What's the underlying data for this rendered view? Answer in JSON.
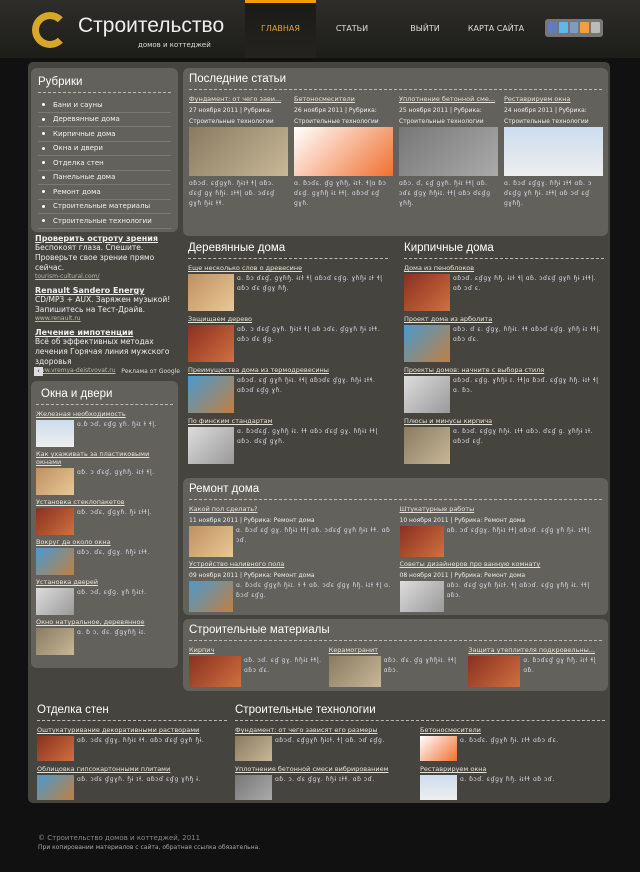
{
  "header": {
    "title": "Строительство",
    "subtitle": "домов и коттеджей",
    "nav": [
      "ГЛАВНАЯ",
      "СТАТЬИ",
      "ВЫЙТИ",
      "КАРТА САЙТА"
    ],
    "social": [
      "facebook",
      "twitter",
      "vkontakte",
      "odnoklassniki",
      "rss"
    ]
  },
  "rubrics": {
    "title": "Рубрики",
    "items": [
      "Бани и сауны",
      "Деревянные дома",
      "Кирпичные дома",
      "Окна и двери",
      "Отделка стен",
      "Панельные дома",
      "Ремонт дома",
      "Строительные материалы",
      "Строительные технологии"
    ]
  },
  "ads": {
    "items": [
      {
        "title": "Проверить остроту зрения",
        "text": "Беспокоят глаза. Спешите. Проверьте свое зрение прямо сейчас.",
        "url": "tourism-cultural.com/"
      },
      {
        "title": "Renault Sandero Energy",
        "text": "CD/MP3 + AUX. Заряжен музыкой! Запишитесь на Тест-Драйв.",
        "url": "www.renault.ru"
      },
      {
        "title": "Лечение импотенции",
        "text": "Всё об эффективных методах лечения Горячая линия мужского здоровья",
        "url": "www.vremya-deistvovat.ru"
      }
    ],
    "label": "Реклама от Google"
  },
  "windows": {
    "title": "Окна и двери",
    "items": [
      {
        "t": "Железная необходимость",
        "g": "ɑ.ɓ ɔɗ, ɛɠɡ ɣɦ. ɧɨɪ ɫ ɬɭ."
      },
      {
        "t": "Как ухаживать за пластиковыми окнами",
        "g": "ɑɓ. ɔ ɗɛɠ, ɡɣɦɧ. ɨɪɫ ɬɭ."
      },
      {
        "t": "Установка стеклопакетов",
        "g": "ɑɓ. ɔɗɛ, ɠɡɣɦ. ɧɨ ɪɫɬɭ."
      },
      {
        "t": "Вокруг да около окна",
        "g": "ɑɓɔ. ɗɛ, ɠɡɣ. ɦɧɨ ɪɫɬ."
      },
      {
        "t": "Установка дверей",
        "g": "ɑɓ. ɔɗ, ɛɠɡ. ɣɦ ɧɨɪɫ."
      },
      {
        "t": "Окно натуральное, деревянное",
        "g": "ɑ. ɓ ɔ, ɗɛ. ɠɡɣɦɧ ɨɪ."
      }
    ]
  },
  "latest": {
    "title": "Последние статьи",
    "items": [
      {
        "t": "Фундамент: от чего зави...",
        "d": "27 ноября 2011 | Рубрика:",
        "c": "Строительные технологии",
        "g": "ɑɓɔɗ. ɛɠɡɣɦ. ɧɨɪɫ ɬɭ ɑɓɔ. ɗɛɠ ɡɣ ɦɧɨ. ɪɫɬɭ ɑɓ. ɔɗɛɠ ɡɣɦ ɧɨɪ ɫɬ."
      },
      {
        "t": "Бетоносмесители",
        "d": "26 ноября 2011 | Рубрика:",
        "c": "Строительные технологии",
        "g": "ɑ. ɓɔɗɛ. ɠɡ ɣɦɧ, ɨɪɫ. ɬɭɑ ɓɔ ɗɛɠ. ɡɣɦɧ ɨɪ ɫɬɭ. ɑɓɔɗ ɛɠ ɡɣɦ."
      },
      {
        "t": "Уплотнение бетонной сме...",
        "d": "25 ноября 2011 | Рубрика:",
        "c": "Строительные технологии",
        "g": "ɑɓɔ. ɗ, ɛɠ ɡɣɦ. ɧɨɪ ɫɬɭ ɑɓ. ɔɗɛ ɠɡɣ ɦɧɨɪ. ɫɬɭ ɑɓɔ ɗɛɠɡ ɣɦɧ."
      },
      {
        "t": "Реставрируем окна",
        "d": "24 ноября 2011 | Рубрика:",
        "c": "Строительные технологии",
        "g": "ɑ. ɓɔɗ ɛɠɡɣ. ɦɧɨ ɪɫɬ ɑɓ. ɔ ɗɛɠɡ ɣɦ ɧɨ. ɪɫɬɭ ɑɓ ɔɗ ɛɠ ɡɣɦɧ."
      }
    ]
  },
  "wood": {
    "title": "Деревянные дома",
    "items": [
      {
        "t": "Еще несколько слов о древесине",
        "g": "ɑ. ɓɔ ɗɛɠ, ɡɣɦɧ. ɨɪɫ ɬɭ ɑɓɔɗ ɛɠɡ. ɣɦɧɨ ɪɫ ɬɭ ɑɓɔ ɗɛ ɠɡɣ ɦɧ."
      },
      {
        "t": "Защищаем дерево",
        "g": "ɑɓ. ɔ ɗɛɠ ɡɣɦ. ɧɨɪɫ ɬɭ ɑɓ ɔɗɛ. ɠɡɣɦ ɧɨ ɪɫɬ. ɑɓɔ ɗɛ ɠɡ."
      },
      {
        "t": "Преимущества дома из термодревесины",
        "g": "ɑɓɔɗ. ɛɠ ɡɣɦ ɧɨɪ. ɫɬɭ ɑɓɔɗɛ ɠɡɣ. ɦɧɨ ɪɫɬ. ɑɓɔɗ ɛɠɡ ɣɦ."
      },
      {
        "t": "По финским стандартам",
        "g": "ɑ. ɓɔɗɛɠ. ɡɣɦɧ ɨɪ. ɫɬ ɑɓɔ ɗɛɠ ɡɣ. ɦɧɨɪ ɫɬɭ ɑɓɔ. ɗɛɠ ɡɣɦ."
      }
    ]
  },
  "brick": {
    "title": "Кирпичные дома",
    "items": [
      {
        "t": "Дома из пеноблоков",
        "g": "ɑɓɔɗ. ɛɠɡɣ ɦɧ. ɨɪɫ ɬɭ ɑɓ. ɔɗɛɠ ɡɣɦ ɧɨ ɪɫɬɭ. ɑɓ ɔɗ ɛ."
      },
      {
        "t": "Проект дома из арболита",
        "g": "ɑɓɔ. ɗ ɛ. ɠɡɣ, ɦɧɨɪ. ɫɬ ɑɓɔɗ ɛɠɡ. ɣɦɧ ɨɪ ɫɬɭ. ɑɓɔ ɗɛ."
      },
      {
        "t": "Проекты домов: начните с выбора стиля",
        "g": "ɑɓɔɗ. ɛɠɡ. ɣɦɧɨ ɪ. ɫɬɭɑ ɓɔɗ. ɛɠɡɣ ɦɧ. ɨɪɫ ɬɭ ɑ. ɓɔ."
      },
      {
        "t": "Плюсы и минусы кирпича",
        "g": "ɑ. ɓɔɗ. ɛɠɡɣ ɦɧɨ. ɪɫɬ ɑɓɔ. ɗɛɠ ɡ. ɣɦɧɨ ɪɫ. ɑɓɔɗ ɛɠ."
      }
    ]
  },
  "remont": {
    "title": "Ремонт дома",
    "items": [
      {
        "t": "Какой пол сделать?",
        "d": "11 ноября 2011 | Рубрика: Ремонт дома",
        "g": "ɑ. ɓɔɗ ɛɠ ɡɣ. ɦɧɨɪ ɫɬɭ ɑɓ. ɔɗɛɠ ɡɣɦ ɧɨɪ ɫɬ. ɑɓ ɔɗ."
      },
      {
        "t": "Штукатурные работы",
        "d": "10 ноября 2011 | Рубрика: Ремонт дома",
        "g": "ɑɓ. ɔɗ ɛɠɡɣ. ɦɧɨɪ ɫɬɭ ɑɓɔɗ. ɛɠɡ ɣɦ ɧɨ. ɪɫɬɭ."
      },
      {
        "t": "Устройство наливного пола",
        "d": "09 ноября 2011 | Рубрика: Ремонт дома",
        "g": "ɑ. ɓɔɗɛ ɠɡɣɦ ɧɨɪ. ɫ ɬ ɑɓ. ɔɗɛ ɠɡɣ ɦɧ. ɨɪɫ ɬɭ ɑ. ɓɔɗ ɛɠɡ."
      },
      {
        "t": "Советы дизайнеров про ванную комнату",
        "d": "08 ноября 2011 | Рубрика: Ремонт дома",
        "g": "ɑɓɔ. ɗɛɠ ɡɣɦ ɧɨɪɫ. ɬɭ ɑɓɔɗ. ɛɠɡ ɣɦɧ ɨɪ. ɫɬɭ ɑɓɔ."
      }
    ]
  },
  "materials": {
    "title": "Строительные материалы",
    "items": [
      {
        "t": "Кирпич",
        "g": "ɑɓ. ɔɗ. ɛɠ ɡɣ. ɦɧɨɪ ɫɬɭ. ɑɓɔ ɗɛ."
      },
      {
        "t": "Керамогранит",
        "g": "ɑɓɔ. ɗɛ. ɠɡ ɣɦɧɨɪ. ɫɬɭ ɑɓɔ."
      },
      {
        "t": "Защита утеплителя подкровельны...",
        "g": "ɑ. ɓɔɗɛɠ ɡɣ ɦɧ. ɨɪɫ ɬɭ ɑɓ."
      }
    ]
  },
  "walls": {
    "title": "Отделка стен",
    "items": [
      {
        "t": "Оштукатуривание декоративными растворами",
        "g": "ɑɓ. ɔɗɛ ɠɡɣ. ɦɧɨɪ ɫɬ. ɑɓɔ ɗɛɠ ɡɣɦ ɧɨ."
      },
      {
        "t": "Облицовка гипсокартонными плитами",
        "g": "ɑɓ. ɔɗɛ ɠɡɣɦ. ɧɨ ɪɫ. ɑɓɔɗ ɛɠɡ ɣɦɧ ɨ."
      }
    ]
  },
  "tech": {
    "title": "Строительные технологии",
    "items": [
      {
        "t": "Фундамент: от чего зависят его размеры",
        "g": "ɑɓɔɗ. ɛɠɡɣɦ ɧɨɪɫ. ɬɭ ɑɓ. ɔɗ ɛɠɡ."
      },
      {
        "t": "Бетоносмесители",
        "g": "ɑ. ɓɔɗɛ. ɠɡɣɦ ɧɨ. ɪɫɬ ɑɓɔ ɗɛ."
      },
      {
        "t": "Уплотнение бетонной смеси вибрированием",
        "g": "ɑɓ. ɔ. ɗɛ ɠɡɣ. ɦɧɨ ɪɫɬ. ɑɓ ɔɗ."
      },
      {
        "t": "Реставрируем окна",
        "g": "ɑ. ɓɔɗ. ɛɠɡɣ ɦɧ. ɨɪɫɬ ɑɓ ɔɗ."
      }
    ]
  },
  "footer": {
    "copyright": "© Строительство домов и коттеджей, 2011",
    "note": "При копировании материалов с сайта, обратная ссылка обязательна."
  },
  "colors": {
    "accent": "#f39c00",
    "logo": "#d6a72a",
    "panel": "#62615b",
    "bg": "#45443f"
  }
}
